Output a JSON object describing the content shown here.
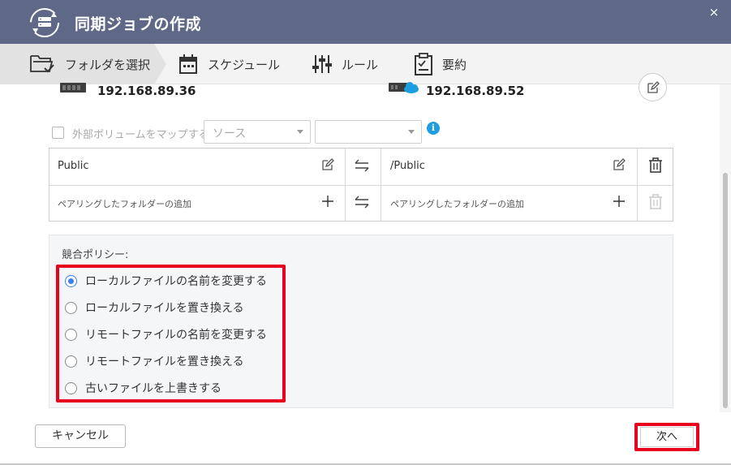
{
  "window": {
    "title": "同期ジョブの作成",
    "close_glyph": "×"
  },
  "steps": [
    {
      "label": "フォルダを選択",
      "icon": "folder-check-icon",
      "active": true
    },
    {
      "label": "スケジュール",
      "icon": "calendar-icon",
      "active": false
    },
    {
      "label": "ルール",
      "icon": "sliders-icon",
      "active": false
    },
    {
      "label": "要約",
      "icon": "clipboard-icon",
      "active": false
    }
  ],
  "devices": {
    "local_ip": "192.168.89.36",
    "remote_ip": "192.168.89.52"
  },
  "map_external": {
    "label": "外部ボリュームをマップする",
    "source_value": "ソース",
    "target_value": ""
  },
  "folders": {
    "rows": [
      {
        "local": "Public",
        "remote": "/Public"
      },
      {
        "local": "ペアリングしたフォルダーの追加",
        "remote": "ペアリングしたフォルダーの追加"
      }
    ]
  },
  "policy": {
    "title": "競合ポリシー:",
    "selected_index": 0,
    "options": [
      "ローカルファイルの名前を変更する",
      "ローカルファイルを置き換える",
      "リモートファイルの名前を変更する",
      "リモートファイルを置き換える",
      "古いファイルを上書きする"
    ]
  },
  "footer": {
    "cancel_label": "キャンセル",
    "next_label": "次へ"
  },
  "colors": {
    "titlebar": "#5f6887",
    "accent": "#3c7ff5",
    "highlight": "#e8001c",
    "info": "#1e9de0"
  }
}
